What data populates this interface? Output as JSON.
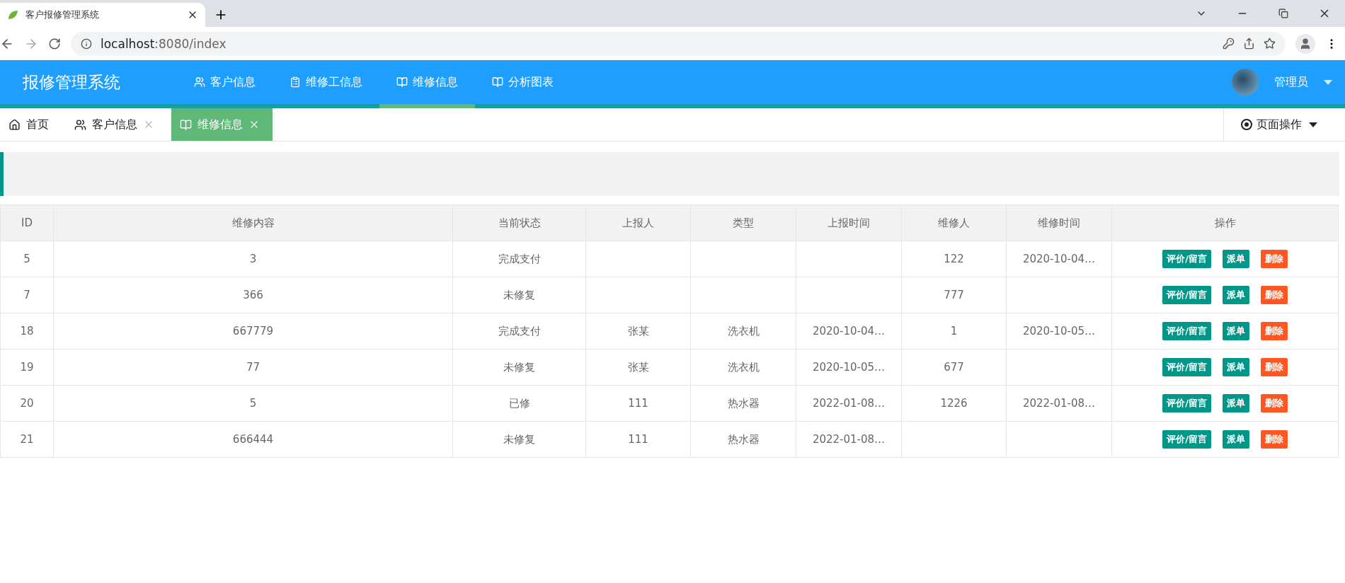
{
  "browser": {
    "tab_title": "客户报修管理系统",
    "url_host": "localhost",
    "url_rest": ":8080/index"
  },
  "header": {
    "logo": "报修管理系统",
    "user": "管理员",
    "nav": [
      {
        "label": "客户信息",
        "selected": false
      },
      {
        "label": "维修工信息",
        "selected": false
      },
      {
        "label": "维修信息",
        "selected": true
      },
      {
        "label": "分析图表",
        "selected": false
      }
    ]
  },
  "page_tabs": [
    {
      "label": "首页",
      "closable": false,
      "selected": false
    },
    {
      "label": "客户信息",
      "closable": true,
      "selected": false
    },
    {
      "label": "维修信息",
      "closable": true,
      "selected": true
    }
  ],
  "page_ops": "页面操作",
  "table": {
    "columns": [
      "ID",
      "维修内容",
      "当前状态",
      "上报人",
      "类型",
      "上报时间",
      "维修人",
      "维修时间",
      "操作"
    ],
    "rows": [
      {
        "cells": [
          "5",
          "3",
          "完成支付",
          null,
          null,
          null,
          "122",
          "2020-10-04…"
        ],
        "actions": [
          {
            "label": "评价/留言",
            "kind": "primary"
          },
          {
            "label": "派单",
            "kind": "primary"
          },
          {
            "label": "删除",
            "kind": "danger"
          }
        ]
      },
      {
        "cells": [
          "7",
          "366",
          "未修复",
          null,
          null,
          null,
          "777",
          null
        ],
        "actions": [
          {
            "label": "评价/留言",
            "kind": "primary"
          },
          {
            "label": "派单",
            "kind": "primary"
          },
          {
            "label": "删除",
            "kind": "danger"
          }
        ]
      },
      {
        "cells": [
          "18",
          "667779",
          "完成支付",
          "张某",
          "洗衣机",
          "2020-10-04…",
          "1",
          "2020-10-05…"
        ],
        "actions": [
          {
            "label": "评价/留言",
            "kind": "primary"
          },
          {
            "label": "派单",
            "kind": "primary"
          },
          {
            "label": "删除",
            "kind": "danger"
          }
        ]
      },
      {
        "cells": [
          "19",
          "77",
          "未修复",
          "张某",
          "洗衣机",
          "2020-10-05…",
          "677",
          null
        ],
        "actions": [
          {
            "label": "评价/留言",
            "kind": "primary"
          },
          {
            "label": "派单",
            "kind": "primary"
          },
          {
            "label": "删除",
            "kind": "danger"
          }
        ]
      },
      {
        "cells": [
          "20",
          "5",
          "已修",
          "111",
          "热水器",
          "2022-01-08…",
          "1226",
          "2022-01-08…"
        ],
        "actions": [
          {
            "label": "评价/留言",
            "kind": "primary"
          },
          {
            "label": "派单",
            "kind": "primary"
          },
          {
            "label": "删除",
            "kind": "danger"
          }
        ]
      },
      {
        "cells": [
          "21",
          "666444",
          "未修复",
          "111",
          "热水器",
          "2022-01-08…",
          null,
          null
        ],
        "actions": [
          {
            "label": "评价/留言",
            "kind": "primary"
          },
          {
            "label": "派单",
            "kind": "primary"
          },
          {
            "label": "删除",
            "kind": "danger"
          }
        ]
      }
    ]
  }
}
